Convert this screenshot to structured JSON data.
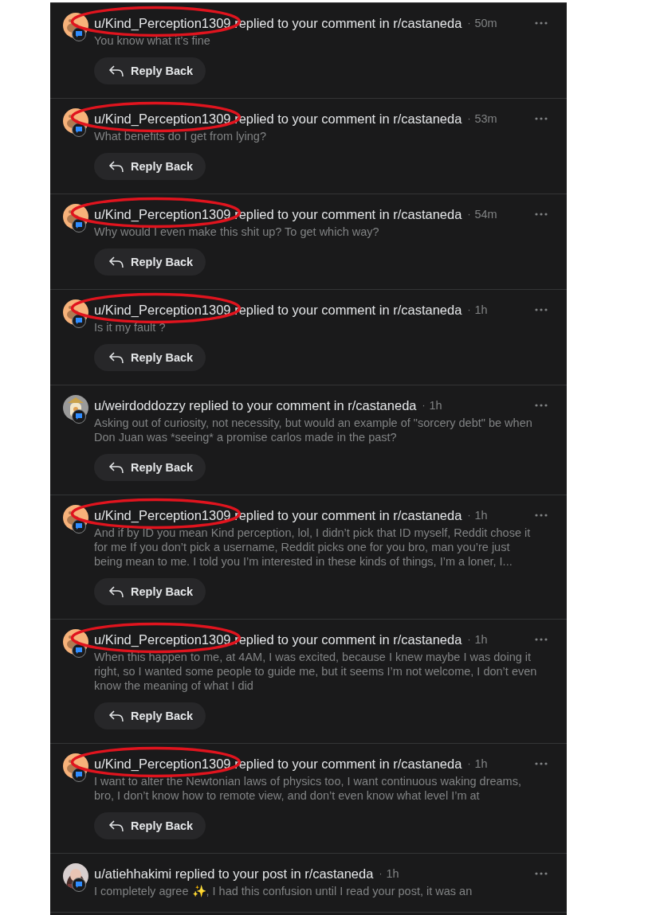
{
  "notifications": [
    {
      "avatar": {
        "kind": "snoo"
      },
      "circled": true,
      "user": "u/Kind_Perception1309",
      "action": "replied to your comment in r/castaneda",
      "dot": "·",
      "time": "50m",
      "body": "You know what it’s fine",
      "button": "Reply Back"
    },
    {
      "avatar": {
        "kind": "snoo"
      },
      "circled": true,
      "user": "u/Kind_Perception1309",
      "action": "replied to your comment in r/castaneda",
      "dot": "·",
      "time": "53m",
      "body": "What benefits do I get from lying?",
      "button": "Reply Back"
    },
    {
      "avatar": {
        "kind": "snoo"
      },
      "circled": true,
      "user": "u/Kind_Perception1309",
      "action": "replied to your comment in r/castaneda",
      "dot": "·",
      "time": "54m",
      "body": "Why would I even make this shit up? To get which way?",
      "button": "Reply Back"
    },
    {
      "avatar": {
        "kind": "snoo"
      },
      "circled": true,
      "user": "u/Kind_Perception1309",
      "action": "replied to your comment in r/castaneda",
      "dot": "·",
      "time": "1h",
      "body": "Is it my fault ?",
      "button": "Reply Back"
    },
    {
      "avatar": {
        "kind": "cartoon"
      },
      "circled": false,
      "user": "u/weirdoddozzy",
      "action": "replied to your comment in r/castaneda",
      "dot": "·",
      "time": "1h",
      "body": "Asking out of curiosity, not necessity, but would an example of \"sorcery debt\" be when Don Juan was *seeing* a promise carlos made in the past?",
      "button": "Reply Back"
    },
    {
      "avatar": {
        "kind": "snoo"
      },
      "circled": true,
      "user": "u/Kind_Perception1309",
      "action": "replied to your comment in r/castaneda",
      "dot": "·",
      "time": "1h",
      "body": "And if by ID you mean Kind perception, lol, I didn’t pick that ID myself, Reddit chose it for me If you don’t pick a username, Reddit picks one for you bro, man you’re just being mean to me. I told you I’m interested in these kinds of things, I’m a loner, I...",
      "button": "Reply Back"
    },
    {
      "avatar": {
        "kind": "snoo"
      },
      "circled": true,
      "user": "u/Kind_Perception1309",
      "action": "replied to your comment in r/castaneda",
      "dot": "·",
      "time": "1h",
      "body": "When this happen to me, at 4AM, I was excited, because I knew maybe I was doing it right, so I wanted some people to guide me, but it seems I’m not welcome, I don’t even know the meaning of what I did",
      "button": "Reply Back"
    },
    {
      "avatar": {
        "kind": "snoo"
      },
      "circled": true,
      "user": "u/Kind_Perception1309",
      "action": "replied to your comment in r/castaneda",
      "dot": "·",
      "time": "1h",
      "body": "I want to alter the Newtonian laws of physics too, I want continuous waking dreams, bro, I don’t know how to remote view, and don’t even know what level I’m at",
      "button": "Reply Back"
    },
    {
      "circled": false,
      "user": "u/atiehhakimi",
      "action": "replied to your post in r/castaneda",
      "dot": "·",
      "time": "1h",
      "body": "I completely agree ✨, I had this confusion until I read your post, it was an"
    }
  ]
}
